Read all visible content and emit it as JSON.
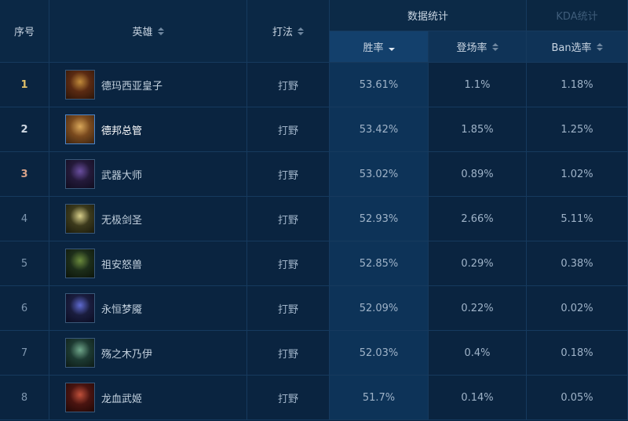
{
  "header": {
    "col_rank": "序号",
    "col_hero": "英雄",
    "col_lane": "打法",
    "group_stats": "数据统计",
    "group_kda": "KDA统计",
    "col_winrate": "胜率",
    "col_pickrate": "登场率",
    "col_banrate": "Ban选率"
  },
  "colors": {
    "background": "#0a2440",
    "active_column": "#0d3358",
    "gold_rank": "#e0c069",
    "silver_rank": "#cfd8e2",
    "bronze_rank": "#d9a38a"
  },
  "rows": [
    {
      "rank": "1",
      "hero": "德玛西亚皇子",
      "icon": "jarvan-avatar",
      "lane": "打野",
      "winrate": "53.61%",
      "pickrate": "1.1%",
      "banrate": "1.18%"
    },
    {
      "rank": "2",
      "hero": "德邦总管",
      "icon": "xin-zhao-avatar",
      "lane": "打野",
      "winrate": "53.42%",
      "pickrate": "1.85%",
      "banrate": "1.25%"
    },
    {
      "rank": "3",
      "hero": "武器大师",
      "icon": "jax-avatar",
      "lane": "打野",
      "winrate": "53.02%",
      "pickrate": "0.89%",
      "banrate": "1.02%"
    },
    {
      "rank": "4",
      "hero": "无极剑圣",
      "icon": "master-yi-avatar",
      "lane": "打野",
      "winrate": "52.93%",
      "pickrate": "2.66%",
      "banrate": "5.11%"
    },
    {
      "rank": "5",
      "hero": "祖安怒兽",
      "icon": "warwick-avatar",
      "lane": "打野",
      "winrate": "52.85%",
      "pickrate": "0.29%",
      "banrate": "0.38%"
    },
    {
      "rank": "6",
      "hero": "永恒梦魇",
      "icon": "nocturne-avatar",
      "lane": "打野",
      "winrate": "52.09%",
      "pickrate": "0.22%",
      "banrate": "0.02%"
    },
    {
      "rank": "7",
      "hero": "殇之木乃伊",
      "icon": "amumu-avatar",
      "lane": "打野",
      "winrate": "52.03%",
      "pickrate": "0.4%",
      "banrate": "0.18%"
    },
    {
      "rank": "8",
      "hero": "龙血武姬",
      "icon": "shyvana-avatar",
      "lane": "打野",
      "winrate": "51.7%",
      "pickrate": "0.14%",
      "banrate": "0.05%"
    }
  ]
}
